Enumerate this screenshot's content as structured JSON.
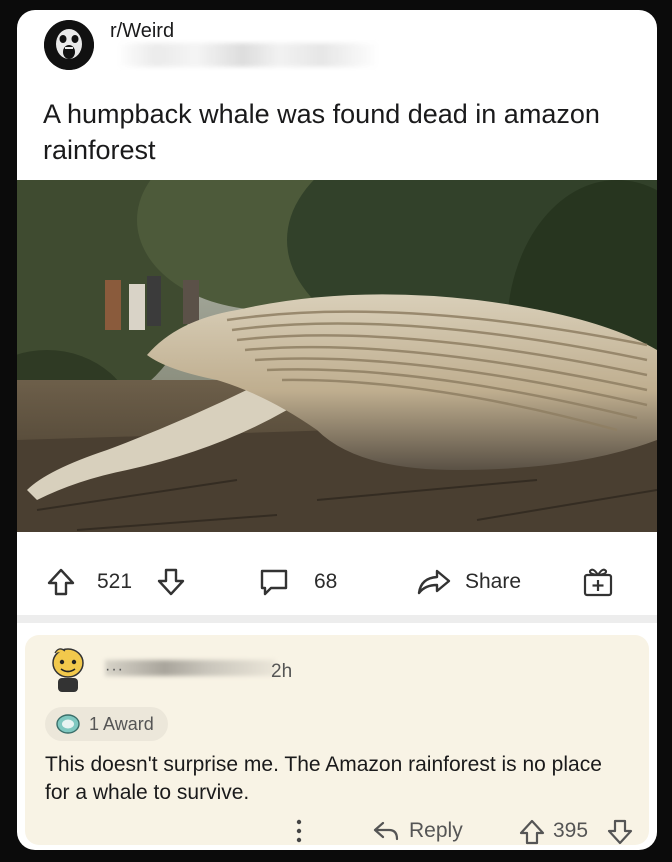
{
  "post": {
    "subreddit": "r/Weird",
    "title": "A humpback whale was found dead in amazon rainforest",
    "upvotes": "521",
    "comments": "68",
    "share_label": "Share"
  },
  "comment": {
    "time": "2h",
    "award_label": "1 Award",
    "body": "This doesn't surprise me. The Amazon rainforest is no place for a whale to survive.",
    "reply_label": "Reply",
    "score": "395"
  }
}
